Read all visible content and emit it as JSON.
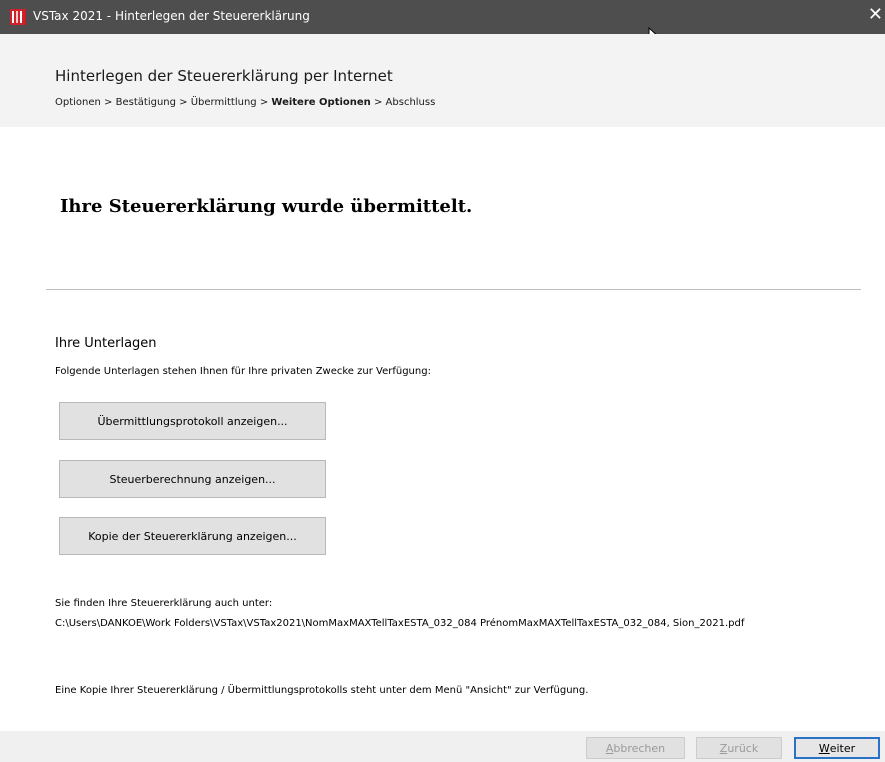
{
  "window": {
    "title": "VSTax 2021 - Hinterlegen der Steuererklärung",
    "close_glyph": "✕",
    "icon": "app-book-icon"
  },
  "header": {
    "title": "Hinterlegen der Steuererklärung per Internet",
    "breadcrumb": {
      "step1": "Optionen",
      "step2": "Bestätigung",
      "step3": "Übermittlung",
      "step4": "Weitere Optionen",
      "step5": "Abschluss",
      "separator": " > "
    }
  },
  "main": {
    "success_message": "Ihre Steuererklärung wurde übermittelt.",
    "documents_title": "Ihre Unterlagen",
    "documents_description": "Folgende Unterlagen stehen Ihnen für Ihre privaten Zwecke zur Verfügung:",
    "buttons": {
      "protocol": "Übermittlungsprotokoll anzeigen...",
      "calculation": "Steuerberechnung anzeigen...",
      "copy": "Kopie der Steuererklärung anzeigen..."
    },
    "location_label": "Sie finden Ihre Steuererklärung auch unter:",
    "location_path": "C:\\Users\\DANKOE\\Work Folders\\VSTax\\VSTax2021\\NomMaxMAXTellTaxESTA_032_084 PrénomMaxMAXTellTaxESTA_032_084, Sion_2021.pdf",
    "copy_info": "Eine Kopie Ihrer Steuererklärung / Übermittlungsprotokolls steht unter dem Menü \"Ansicht\" zur Verfügung."
  },
  "footer": {
    "cancel_first": "A",
    "cancel_rest": "bbrechen",
    "back_first": "Z",
    "back_rest": "urück",
    "next_first": "W",
    "next_rest": "eiter"
  },
  "colors": {
    "titlebar": "#4e4e4e",
    "header_bg": "#f3f3f3",
    "primary_border": "#2a72c8",
    "icon_red": "#d0202a"
  }
}
